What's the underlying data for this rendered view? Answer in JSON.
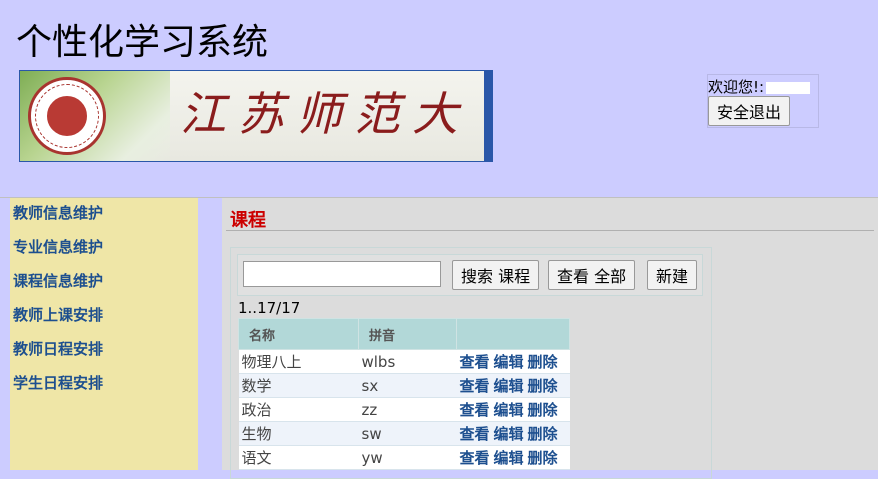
{
  "header": {
    "title": "个性化学习系统",
    "banner_text": "江苏师范大学",
    "welcome_label": "欢迎您!:",
    "logout_label": "安全退出"
  },
  "sidebar": {
    "items": [
      {
        "label": "教师信息维护"
      },
      {
        "label": "专业信息维护"
      },
      {
        "label": "课程信息维护"
      },
      {
        "label": "教师上课安排"
      },
      {
        "label": "教师日程安排"
      },
      {
        "label": "学生日程安排"
      }
    ]
  },
  "main": {
    "title": "课程",
    "search_value": "",
    "search_button": "搜索 课程",
    "view_all_button": "查看 全部",
    "new_button": "新建",
    "record_count": "1..17/17",
    "columns": [
      "名称",
      "拼音",
      ""
    ],
    "rows": [
      {
        "name": "物理八上",
        "pinyin": "wlbs"
      },
      {
        "name": "数学",
        "pinyin": "sx"
      },
      {
        "name": "政治",
        "pinyin": "zz"
      },
      {
        "name": "生物",
        "pinyin": "sw"
      },
      {
        "name": "语文",
        "pinyin": "yw"
      }
    ],
    "actions": {
      "view": "查看",
      "edit": "编辑",
      "delete": "删除"
    }
  },
  "colors": {
    "header_bg": "#ccccff",
    "sidebar_bg": "#efe6a7",
    "main_bg": "#dcdcdc",
    "page_title": "#cc0000",
    "link": "#1d4f8f",
    "table_header": "#b2d8d8"
  }
}
